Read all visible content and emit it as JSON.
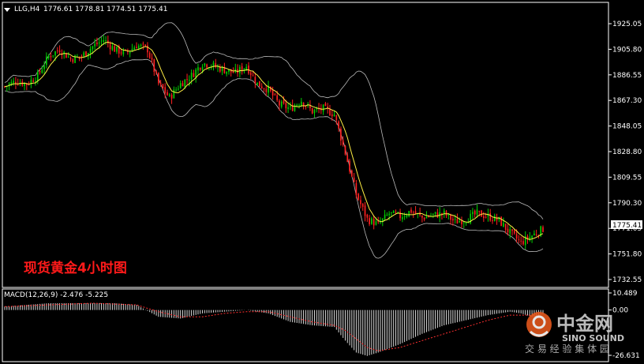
{
  "header": {
    "symbol": "LLG,H4",
    "ohlc": "1776.61 1778.81 1774.51 1775.41"
  },
  "chart_title": "现货黄金4小时图",
  "macd_label": "MACD(12,26,9) -2.476 -5.225",
  "current_price": "1775.41",
  "watermark": {
    "brand_cn": "中金网",
    "brand_en": "SINO SOUND",
    "tagline": "交 易 经 验 集 体 园"
  },
  "colors": {
    "background": "#000000",
    "bull": "#00d000",
    "bear": "#ff2020",
    "ma": "#ffee44",
    "band": "#bbbbbb",
    "macd_hist": "#d8d8d8",
    "macd_signal": "#ff3030",
    "title": "#ff1a1a"
  },
  "chart_data": {
    "type": "candlestick",
    "price_axis_ticks": [
      "1925.05",
      "1905.80",
      "1886.55",
      "1867.30",
      "1848.05",
      "1828.80",
      "1809.55",
      "1790.30",
      "1771.05",
      "1751.80",
      "1732.55"
    ],
    "macd_axis_ticks": [
      "10.489",
      "0.00",
      "-26.631"
    ],
    "ylim": [
      1732.55,
      1939
    ],
    "macd_ylim": [
      -26.631,
      10.489
    ],
    "indicators": [
      "Bollinger Bands",
      "Moving Average",
      "MACD(12,26,9)"
    ],
    "close_path": [
      [
        0,
        1878
      ],
      [
        5,
        1882
      ],
      [
        10,
        1880
      ],
      [
        15,
        1886
      ],
      [
        20,
        1900
      ],
      [
        25,
        1905
      ],
      [
        30,
        1898
      ],
      [
        35,
        1900
      ],
      [
        40,
        1907
      ],
      [
        45,
        1912
      ],
      [
        50,
        1905
      ],
      [
        55,
        1902
      ],
      [
        60,
        1908
      ],
      [
        65,
        1905
      ],
      [
        70,
        1880
      ],
      [
        75,
        1870
      ],
      [
        80,
        1880
      ],
      [
        85,
        1886
      ],
      [
        90,
        1895
      ],
      [
        95,
        1893
      ],
      [
        100,
        1890
      ],
      [
        105,
        1888
      ],
      [
        110,
        1893
      ],
      [
        115,
        1880
      ],
      [
        120,
        1876
      ],
      [
        125,
        1865
      ],
      [
        130,
        1862
      ],
      [
        135,
        1868
      ],
      [
        140,
        1860
      ],
      [
        145,
        1862
      ],
      [
        150,
        1858
      ],
      [
        155,
        1830
      ],
      [
        160,
        1800
      ],
      [
        165,
        1782
      ],
      [
        170,
        1778
      ],
      [
        175,
        1786
      ],
      [
        180,
        1784
      ],
      [
        185,
        1788
      ],
      [
        190,
        1783
      ],
      [
        195,
        1785
      ],
      [
        200,
        1786
      ],
      [
        205,
        1780
      ],
      [
        210,
        1782
      ],
      [
        215,
        1786
      ],
      [
        220,
        1784
      ],
      [
        225,
        1781
      ],
      [
        230,
        1772
      ],
      [
        235,
        1765
      ],
      [
        240,
        1770
      ],
      [
        245,
        1775
      ]
    ],
    "macd_main_path": [
      [
        0,
        2
      ],
      [
        10,
        3
      ],
      [
        20,
        4
      ],
      [
        30,
        4
      ],
      [
        40,
        4
      ],
      [
        50,
        4
      ],
      [
        60,
        3
      ],
      [
        70,
        -4
      ],
      [
        80,
        -5
      ],
      [
        90,
        -2
      ],
      [
        100,
        -1
      ],
      [
        110,
        0
      ],
      [
        120,
        -2
      ],
      [
        130,
        -7
      ],
      [
        140,
        -9
      ],
      [
        150,
        -10
      ],
      [
        155,
        -18
      ],
      [
        160,
        -25
      ],
      [
        165,
        -27
      ],
      [
        170,
        -25
      ],
      [
        180,
        -20
      ],
      [
        190,
        -14
      ],
      [
        200,
        -9
      ],
      [
        210,
        -6
      ],
      [
        220,
        -3
      ],
      [
        230,
        -1
      ],
      [
        235,
        -2
      ],
      [
        240,
        -4
      ],
      [
        245,
        -2.5
      ]
    ],
    "macd_signal_path": [
      [
        0,
        2
      ],
      [
        20,
        3
      ],
      [
        40,
        4
      ],
      [
        60,
        3
      ],
      [
        70,
        -1
      ],
      [
        80,
        -4
      ],
      [
        90,
        -4
      ],
      [
        100,
        -2
      ],
      [
        110,
        -1
      ],
      [
        120,
        -1
      ],
      [
        130,
        -4
      ],
      [
        140,
        -7
      ],
      [
        150,
        -9
      ],
      [
        155,
        -12
      ],
      [
        160,
        -17
      ],
      [
        165,
        -22
      ],
      [
        170,
        -24
      ],
      [
        180,
        -22
      ],
      [
        190,
        -18
      ],
      [
        200,
        -14
      ],
      [
        210,
        -10
      ],
      [
        220,
        -6
      ],
      [
        230,
        -3
      ],
      [
        240,
        -3
      ],
      [
        245,
        -5.2
      ]
    ]
  }
}
